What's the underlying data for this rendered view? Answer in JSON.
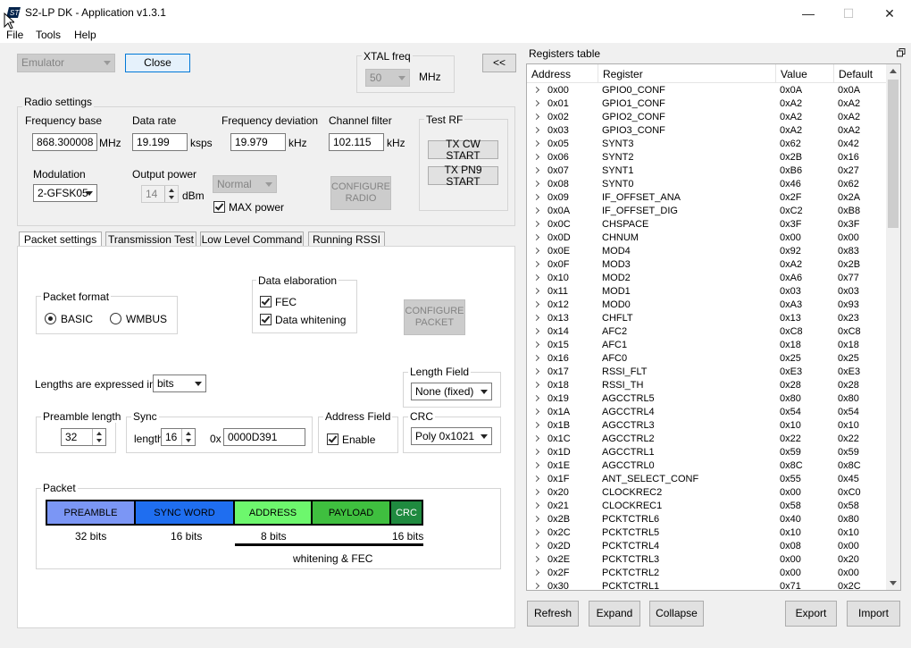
{
  "window": {
    "title": "S2-LP DK - Application v1.3.1",
    "minimize": "—",
    "maximize": "☐",
    "close": "✕"
  },
  "menu": [
    "File",
    "Tools",
    "Help"
  ],
  "top": {
    "device_select": "Emulator",
    "close_button": "Close",
    "xtal_label": "XTAL freq",
    "xtal_value": "50",
    "xtal_unit": "MHz",
    "collapse_button": "<<"
  },
  "radio": {
    "group_label": "Radio settings",
    "freq_base_label": "Frequency base",
    "freq_base_value": "868.300008",
    "freq_base_unit": "MHz",
    "data_rate_label": "Data rate",
    "data_rate_value": "19.199",
    "data_rate_unit": "ksps",
    "freq_dev_label": "Frequency deviation",
    "freq_dev_value": "19.979",
    "freq_dev_unit": "kHz",
    "channel_filter_label": "Channel filter",
    "channel_filter_value": "102.115",
    "channel_filter_unit": "kHz",
    "modulation_label": "Modulation",
    "modulation_value": "2-GFSK05",
    "output_power_label": "Output power",
    "output_power_value": "14",
    "output_power_unit": "dBm",
    "power_mode_value": "Normal",
    "max_power_label": "MAX power",
    "configure_button": "CONFIGURE RADIO",
    "test_rf_label": "Test RF",
    "tx_cw_button": "TX CW START",
    "tx_pn9_button": "TX PN9 START"
  },
  "tabs": [
    "Packet settings",
    "Transmission Test",
    "Low Level Command",
    "Running RSSI"
  ],
  "packet": {
    "format_label": "Packet format",
    "format_basic": "BASIC",
    "format_wmbus": "WMBUS",
    "data_elab_label": "Data elaboration",
    "fec_label": "FEC",
    "whitening_label": "Data whitening",
    "configure_button": "CONFIGURE PACKET",
    "lengths_label": "Lengths are expressed in",
    "lengths_value": "bits",
    "length_field_label": "Length Field",
    "length_field_value": "None (fixed)",
    "preamble_label": "Preamble length",
    "preamble_value": "32",
    "sync_label": "Sync",
    "sync_length_label": "length",
    "sync_length_value": "16",
    "sync_hex_prefix": "0x",
    "sync_value": "0000D391",
    "address_field_label": "Address Field",
    "address_enable_label": "Enable",
    "crc_label": "CRC",
    "crc_value": "Poly 0x1021",
    "diagram_label": "Packet",
    "blocks": [
      {
        "label": "PREAMBLE",
        "bits": "32 bits",
        "color": "#7b96f5"
      },
      {
        "label": "SYNC WORD",
        "bits": "16 bits",
        "color": "#1f6ef0"
      },
      {
        "label": "ADDRESS",
        "bits": "8 bits",
        "color": "#6df76d"
      },
      {
        "label": "PAYLOAD",
        "bits": "",
        "color": "#3fbf3f"
      },
      {
        "label": "CRC",
        "bits": "16 bits",
        "color": "#1f8a3f"
      }
    ],
    "whitening_fec_label": "whitening & FEC"
  },
  "registers": {
    "panel_title": "Registers table",
    "columns": [
      "Address",
      "Register",
      "Value",
      "Default"
    ],
    "rows": [
      [
        "0x00",
        "GPIO0_CONF",
        "0x0A",
        "0x0A"
      ],
      [
        "0x01",
        "GPIO1_CONF",
        "0xA2",
        "0xA2"
      ],
      [
        "0x02",
        "GPIO2_CONF",
        "0xA2",
        "0xA2"
      ],
      [
        "0x03",
        "GPIO3_CONF",
        "0xA2",
        "0xA2"
      ],
      [
        "0x05",
        "SYNT3",
        "0x62",
        "0x42"
      ],
      [
        "0x06",
        "SYNT2",
        "0x2B",
        "0x16"
      ],
      [
        "0x07",
        "SYNT1",
        "0xB6",
        "0x27"
      ],
      [
        "0x08",
        "SYNT0",
        "0x46",
        "0x62"
      ],
      [
        "0x09",
        "IF_OFFSET_ANA",
        "0x2F",
        "0x2A"
      ],
      [
        "0x0A",
        "IF_OFFSET_DIG",
        "0xC2",
        "0xB8"
      ],
      [
        "0x0C",
        "CHSPACE",
        "0x3F",
        "0x3F"
      ],
      [
        "0x0D",
        "CHNUM",
        "0x00",
        "0x00"
      ],
      [
        "0x0E",
        "MOD4",
        "0x92",
        "0x83"
      ],
      [
        "0x0F",
        "MOD3",
        "0xA2",
        "0x2B"
      ],
      [
        "0x10",
        "MOD2",
        "0xA6",
        "0x77"
      ],
      [
        "0x11",
        "MOD1",
        "0x03",
        "0x03"
      ],
      [
        "0x12",
        "MOD0",
        "0xA3",
        "0x93"
      ],
      [
        "0x13",
        "CHFLT",
        "0x13",
        "0x23"
      ],
      [
        "0x14",
        "AFC2",
        "0xC8",
        "0xC8"
      ],
      [
        "0x15",
        "AFC1",
        "0x18",
        "0x18"
      ],
      [
        "0x16",
        "AFC0",
        "0x25",
        "0x25"
      ],
      [
        "0x17",
        "RSSI_FLT",
        "0xE3",
        "0xE3"
      ],
      [
        "0x18",
        "RSSI_TH",
        "0x28",
        "0x28"
      ],
      [
        "0x19",
        "AGCCTRL5",
        "0x80",
        "0x80"
      ],
      [
        "0x1A",
        "AGCCTRL4",
        "0x54",
        "0x54"
      ],
      [
        "0x1B",
        "AGCCTRL3",
        "0x10",
        "0x10"
      ],
      [
        "0x1C",
        "AGCCTRL2",
        "0x22",
        "0x22"
      ],
      [
        "0x1D",
        "AGCCTRL1",
        "0x59",
        "0x59"
      ],
      [
        "0x1E",
        "AGCCTRL0",
        "0x8C",
        "0x8C"
      ],
      [
        "0x1F",
        "ANT_SELECT_CONF",
        "0x55",
        "0x45"
      ],
      [
        "0x20",
        "CLOCKREC2",
        "0x00",
        "0xC0"
      ],
      [
        "0x21",
        "CLOCKREC1",
        "0x58",
        "0x58"
      ],
      [
        "0x2B",
        "PCKTCTRL6",
        "0x40",
        "0x80"
      ],
      [
        "0x2C",
        "PCKTCTRL5",
        "0x10",
        "0x10"
      ],
      [
        "0x2D",
        "PCKTCTRL4",
        "0x08",
        "0x00"
      ],
      [
        "0x2E",
        "PCKTCTRL3",
        "0x00",
        "0x20"
      ],
      [
        "0x2F",
        "PCKTCTRL2",
        "0x00",
        "0x00"
      ],
      [
        "0x30",
        "PCKTCTRL1",
        "0x71",
        "0x2C"
      ]
    ],
    "buttons": {
      "refresh": "Refresh",
      "expand": "Expand",
      "collapse": "Collapse",
      "export": "Export",
      "import": "Import"
    }
  }
}
